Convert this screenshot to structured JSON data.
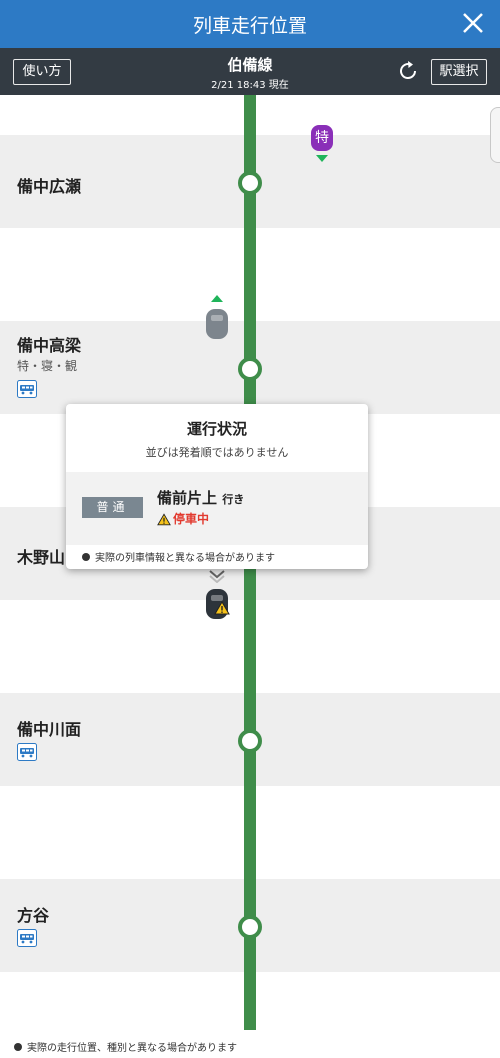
{
  "header": {
    "title": "列車走行位置",
    "close_icon": "close-icon"
  },
  "subheader": {
    "usage_label": "使い方",
    "line_name": "伯備線",
    "updated": "2/21 18:43 現在",
    "refresh_icon": "refresh-icon",
    "station_select_label": "駅選択"
  },
  "stations": [
    {
      "name": "備中広瀬"
    },
    {
      "name": "備中高梁",
      "sub": "特・寝・観",
      "has_bus": true
    },
    {
      "name": "木野山"
    },
    {
      "name": "備中川面",
      "has_bus": true
    },
    {
      "name": "方谷",
      "has_bus": true
    }
  ],
  "trains": {
    "limited_express_badge": "特",
    "colors": {
      "track": "#3f8d4a",
      "limited": "#8a2fb8",
      "direction": "#1fb45a",
      "warning": "#e23a2f"
    }
  },
  "popup": {
    "title": "運行状況",
    "note": "並びは発着順ではありません",
    "train_kind": "普通",
    "destination": "備前片上",
    "destination_suffix": "行き",
    "status": "停車中",
    "footer_note": "実際の列車情報と異なる場合があります"
  },
  "footer": {
    "note": "実際の走行位置、種別と異なる場合があります"
  }
}
